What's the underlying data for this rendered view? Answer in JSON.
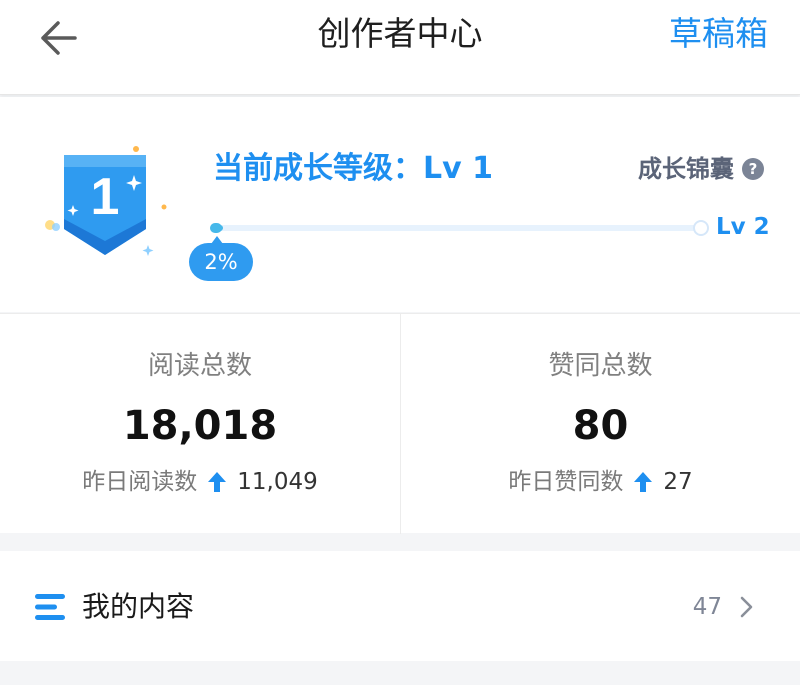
{
  "header": {
    "title": "创作者中心",
    "draft_label": "草稿箱",
    "back_icon": "arrow-left-icon"
  },
  "level": {
    "title": "当前成长等级：Lv 1",
    "badge_number": "1",
    "tips_label": "成长锦囊",
    "help_glyph": "?",
    "next_level": "Lv 2",
    "progress_label": "2%",
    "progress_fraction": 0.02
  },
  "stats": {
    "reads": {
      "label": "阅读总数",
      "value": "18,018",
      "yesterday_label": "昨日阅读数",
      "yesterday_value": "11,049"
    },
    "likes": {
      "label": "赞同总数",
      "value": "80",
      "yesterday_label": "昨日赞同数",
      "yesterday_value": "27"
    }
  },
  "content": {
    "label": "我的内容",
    "count": "47"
  },
  "colors": {
    "accent": "#1e8ff0",
    "progress": "#46b8ea",
    "badge_blue": "#2f9bf0"
  }
}
